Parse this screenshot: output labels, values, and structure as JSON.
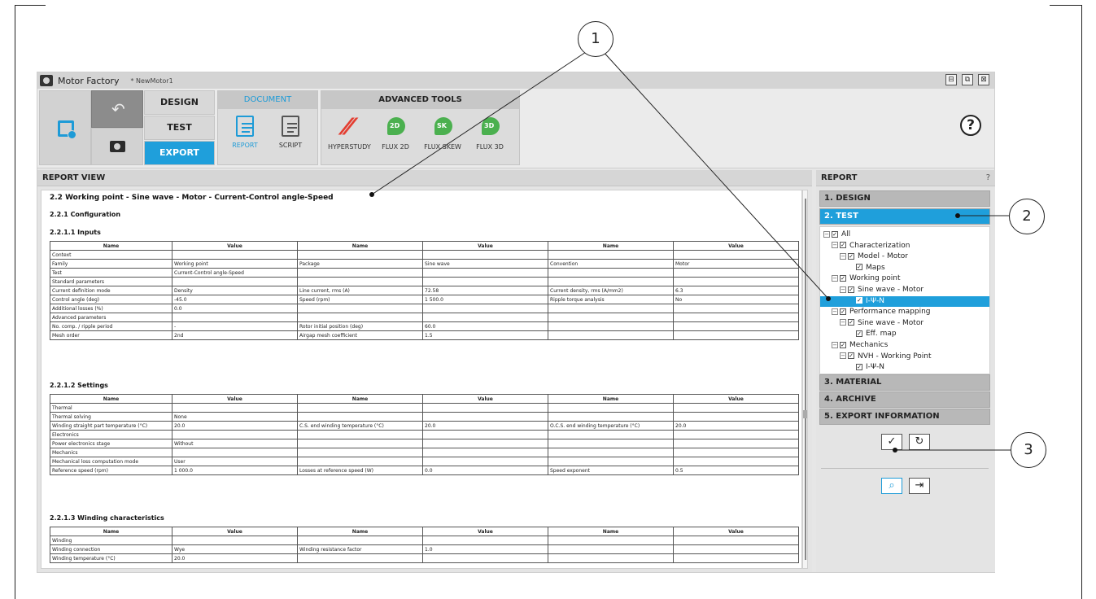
{
  "app": {
    "title": "Motor Factory",
    "document": "* NewMotor1",
    "window_controls": [
      "⊟",
      "⧉",
      "⊠"
    ]
  },
  "ribbon": {
    "modes": [
      "DESIGN",
      "TEST",
      "EXPORT"
    ],
    "active_mode": "EXPORT",
    "document_group": {
      "header": "DOCUMENT",
      "tools": [
        "REPORT",
        "SCRIPT"
      ]
    },
    "advanced_group": {
      "header": "ADVANCED TOOLS",
      "tools": [
        "HYPERSTUDY",
        "FLUX 2D",
        "FLUX SKEW",
        "FLUX 3D"
      ],
      "flux_badges": [
        "2D",
        "SK",
        "3D"
      ]
    },
    "help": "?"
  },
  "report_view": {
    "header": "REPORT VIEW",
    "title": "2.2 Working point - Sine wave - Motor - Current-Control angle-Speed",
    "config_title": "2.2.1 Configuration",
    "inputs_title": "2.2.1.1 Inputs",
    "settings_title": "2.2.1.2 Settings",
    "winding_title": "2.2.1.3 Winding characteristics",
    "columns": [
      "Name",
      "Value",
      "Name",
      "Value",
      "Name",
      "Value"
    ],
    "inputs_rows": [
      [
        "Context",
        "",
        "",
        "",
        "",
        ""
      ],
      [
        "Family",
        "Working point",
        "Package",
        "Sine wave",
        "Convention",
        "Motor"
      ],
      [
        "Test",
        "Current-Control angle-Speed",
        "",
        "",
        "",
        ""
      ],
      [
        "Standard parameters",
        "",
        "",
        "",
        "",
        ""
      ],
      [
        "Current definition mode",
        "Density",
        "Line current, rms (A)",
        "72.58",
        "Current density, rms (A/mm2)",
        "6.3"
      ],
      [
        "Control angle (deg)",
        "-45.0",
        "Speed (rpm)",
        "1 500.0",
        "Ripple torque analysis",
        "No"
      ],
      [
        "Additional losses (%)",
        "0.0",
        "",
        "",
        "",
        ""
      ],
      [
        "Advanced parameters",
        "",
        "",
        "",
        "",
        ""
      ],
      [
        "No. comp. / ripple period",
        "-",
        "Rotor initial position (deg)",
        "60.0",
        "",
        ""
      ],
      [
        "Mesh order",
        "2nd",
        "Airgap mesh coefficient",
        "1.5",
        "",
        ""
      ]
    ],
    "settings_rows": [
      [
        "Thermal",
        "",
        "",
        "",
        "",
        ""
      ],
      [
        "Thermal solving",
        "None",
        "",
        "",
        "",
        ""
      ],
      [
        "Winding straight part temperature (°C)",
        "20.0",
        "C.S. end winding temperature (°C)",
        "20.0",
        "O.C.S. end winding temperature (°C)",
        "20.0"
      ],
      [
        "Electronics",
        "",
        "",
        "",
        "",
        ""
      ],
      [
        "Power electronics stage",
        "Without",
        "",
        "",
        "",
        ""
      ],
      [
        "Mechanics",
        "",
        "",
        "",
        "",
        ""
      ],
      [
        "Mechanical loss computation mode",
        "User",
        "",
        "",
        "",
        ""
      ],
      [
        "Reference speed (rpm)",
        "1 000.0",
        "Losses at reference speed (W)",
        "0.0",
        "Speed exponent",
        "0.5"
      ]
    ],
    "winding_rows": [
      [
        "Winding",
        "",
        "",
        "",
        "",
        ""
      ],
      [
        "Winding connection",
        "Wye",
        "Winding resistance factor",
        "1.0",
        "",
        ""
      ],
      [
        "Winding temperature (°C)",
        "20.0",
        "",
        "",
        "",
        ""
      ]
    ]
  },
  "report_panel": {
    "header": "REPORT",
    "help": "?",
    "sections": [
      "1. DESIGN",
      "2. TEST",
      "3. MATERIAL",
      "4. ARCHIVE",
      "5. EXPORT INFORMATION"
    ],
    "active_section": "2. TEST",
    "tree": [
      {
        "label": "All",
        "level": 0,
        "expander": true,
        "selected": false
      },
      {
        "label": "Characterization",
        "level": 1,
        "expander": true,
        "selected": false
      },
      {
        "label": "Model - Motor",
        "level": 2,
        "expander": true,
        "selected": false
      },
      {
        "label": "Maps",
        "level": 3,
        "expander": false,
        "selected": false
      },
      {
        "label": "Working point",
        "level": 1,
        "expander": true,
        "selected": false
      },
      {
        "label": "Sine wave - Motor",
        "level": 2,
        "expander": true,
        "selected": false
      },
      {
        "label": "I-Ψ-N",
        "level": 3,
        "expander": false,
        "selected": true
      },
      {
        "label": "Performance mapping",
        "level": 1,
        "expander": true,
        "selected": false
      },
      {
        "label": "Sine wave - Motor",
        "level": 2,
        "expander": true,
        "selected": false
      },
      {
        "label": "Eff. map",
        "level": 3,
        "expander": false,
        "selected": false
      },
      {
        "label": "Mechanics",
        "level": 1,
        "expander": true,
        "selected": false
      },
      {
        "label": "NVH - Working Point",
        "level": 2,
        "expander": true,
        "selected": false
      },
      {
        "label": "I-Ψ-N",
        "level": 3,
        "expander": false,
        "selected": false
      }
    ]
  },
  "callouts": [
    "1",
    "2",
    "3"
  ]
}
